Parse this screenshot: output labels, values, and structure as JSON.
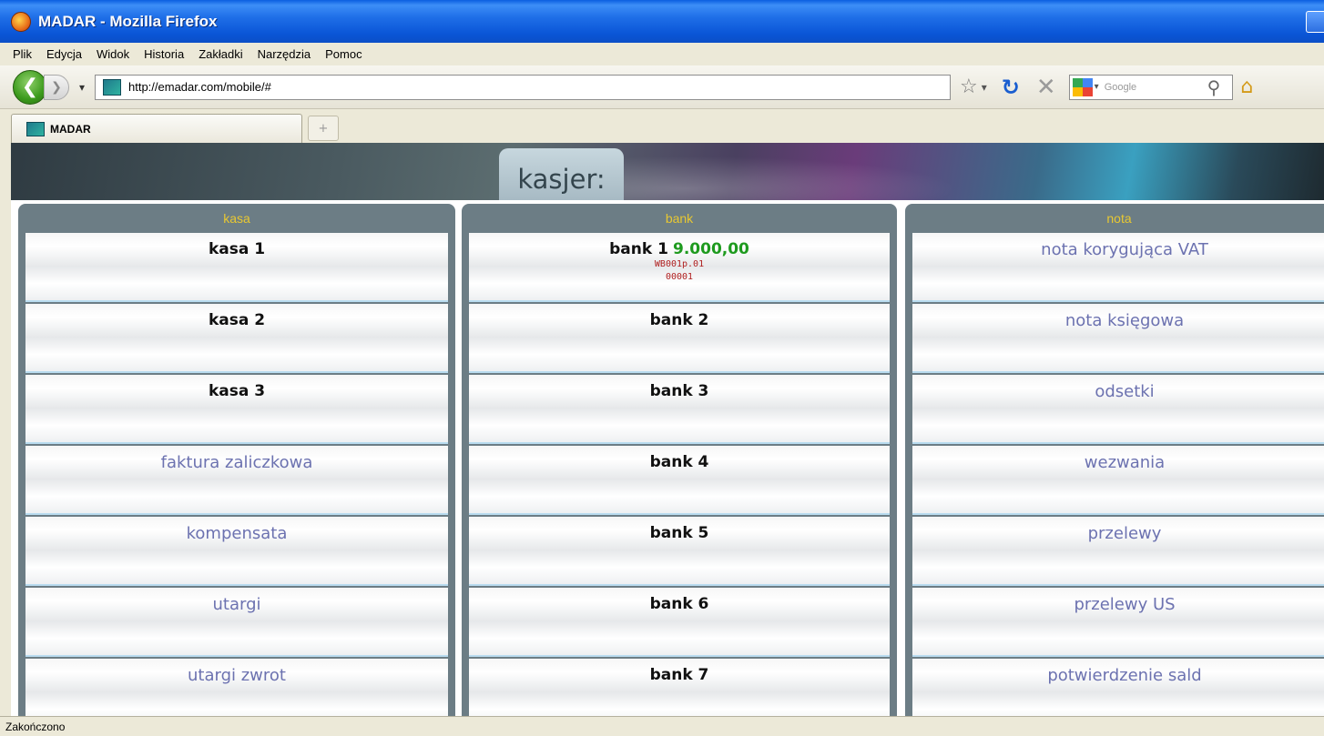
{
  "window": {
    "title": "MADAR - Mozilla Firefox"
  },
  "menu": [
    "Plik",
    "Edycja",
    "Widok",
    "Historia",
    "Zakładki",
    "Narzędzia",
    "Pomoc"
  ],
  "navbar": {
    "url": "http://emadar.com/mobile/#",
    "search_placeholder": "Google"
  },
  "tab": {
    "label": "MADAR",
    "new_tab": "+"
  },
  "page": {
    "title": "kasjer:"
  },
  "columns": {
    "kasa": {
      "header": "kasa",
      "items": [
        {
          "label": "kasa 1",
          "style": "bold"
        },
        {
          "label": "kasa 2",
          "style": "bold"
        },
        {
          "label": "kasa 3",
          "style": "bold"
        },
        {
          "label": "faktura zaliczkowa",
          "style": "link"
        },
        {
          "label": "kompensata",
          "style": "link"
        },
        {
          "label": "utargi",
          "style": "link"
        },
        {
          "label": "utargi zwrot",
          "style": "link"
        }
      ]
    },
    "bank": {
      "header": "bank",
      "items": [
        {
          "label": "bank 1",
          "amount": "9.000,00",
          "sub1": "WB001p.01",
          "sub2": "00001"
        },
        {
          "label": "bank 2"
        },
        {
          "label": "bank 3"
        },
        {
          "label": "bank 4"
        },
        {
          "label": "bank 5"
        },
        {
          "label": "bank 6"
        },
        {
          "label": "bank 7"
        }
      ]
    },
    "nota": {
      "header": "nota",
      "items": [
        {
          "label": "nota korygująca VAT"
        },
        {
          "label": "nota księgowa"
        },
        {
          "label": "odsetki"
        },
        {
          "label": "wezwania"
        },
        {
          "label": "przelewy"
        },
        {
          "label": "przelewy US"
        },
        {
          "label": "potwierdzenie sald"
        }
      ]
    }
  },
  "status": {
    "text": "Zakończono"
  },
  "colors": {
    "header_text": "#e8c832",
    "link": "#6c72b0",
    "amount": "#1e9a1e",
    "sub": "#b02020"
  }
}
